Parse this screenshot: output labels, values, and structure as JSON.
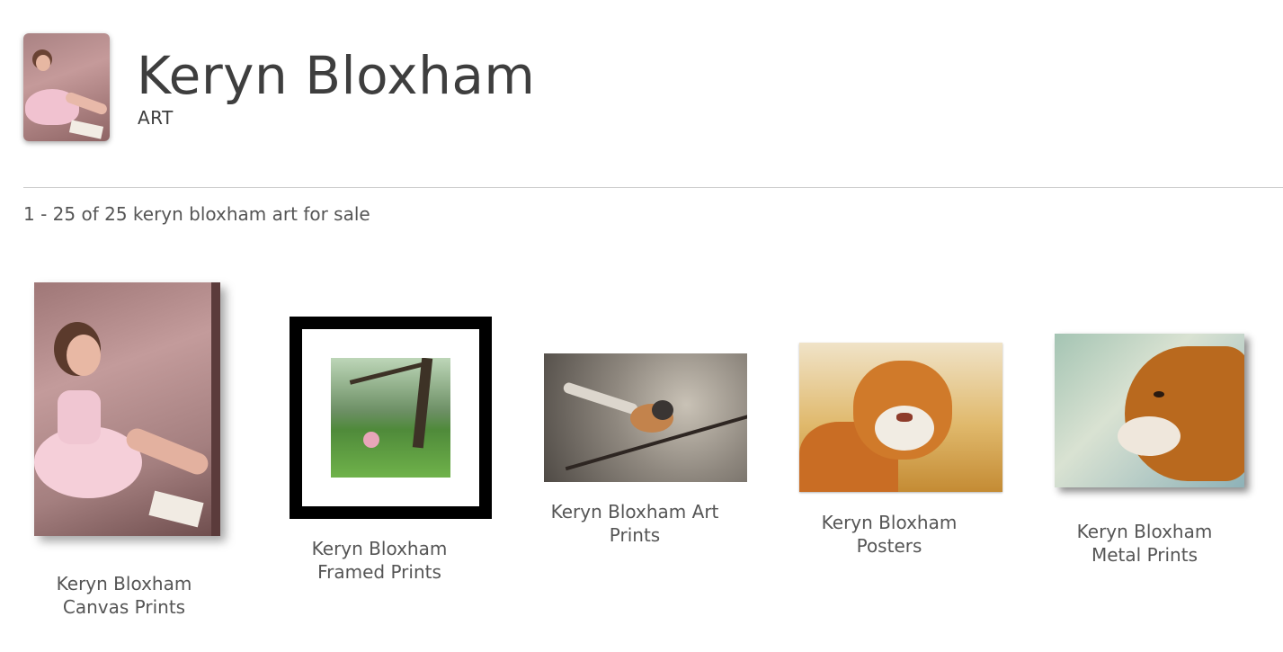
{
  "header": {
    "artist_name": "Keryn Bloxham",
    "section": "ART"
  },
  "results": {
    "summary": "1 - 25 of 25 keryn bloxham art for sale"
  },
  "products": [
    {
      "label_line1": "Keryn Bloxham",
      "label_line2": "Canvas Prints",
      "icon": "canvas-print-image"
    },
    {
      "label_line1": "Keryn Bloxham",
      "label_line2": "Framed Prints",
      "icon": "framed-print-image"
    },
    {
      "label_line1": "Keryn Bloxham Art",
      "label_line2": "Prints",
      "icon": "art-print-image"
    },
    {
      "label_line1": "Keryn Bloxham",
      "label_line2": "Posters",
      "icon": "poster-image"
    },
    {
      "label_line1": "Keryn Bloxham",
      "label_line2": "Metal Prints",
      "icon": "metal-print-image"
    }
  ],
  "colors": {
    "text": "#3e3e3e",
    "divider": "#cfcfcf",
    "background": "#ffffff"
  }
}
